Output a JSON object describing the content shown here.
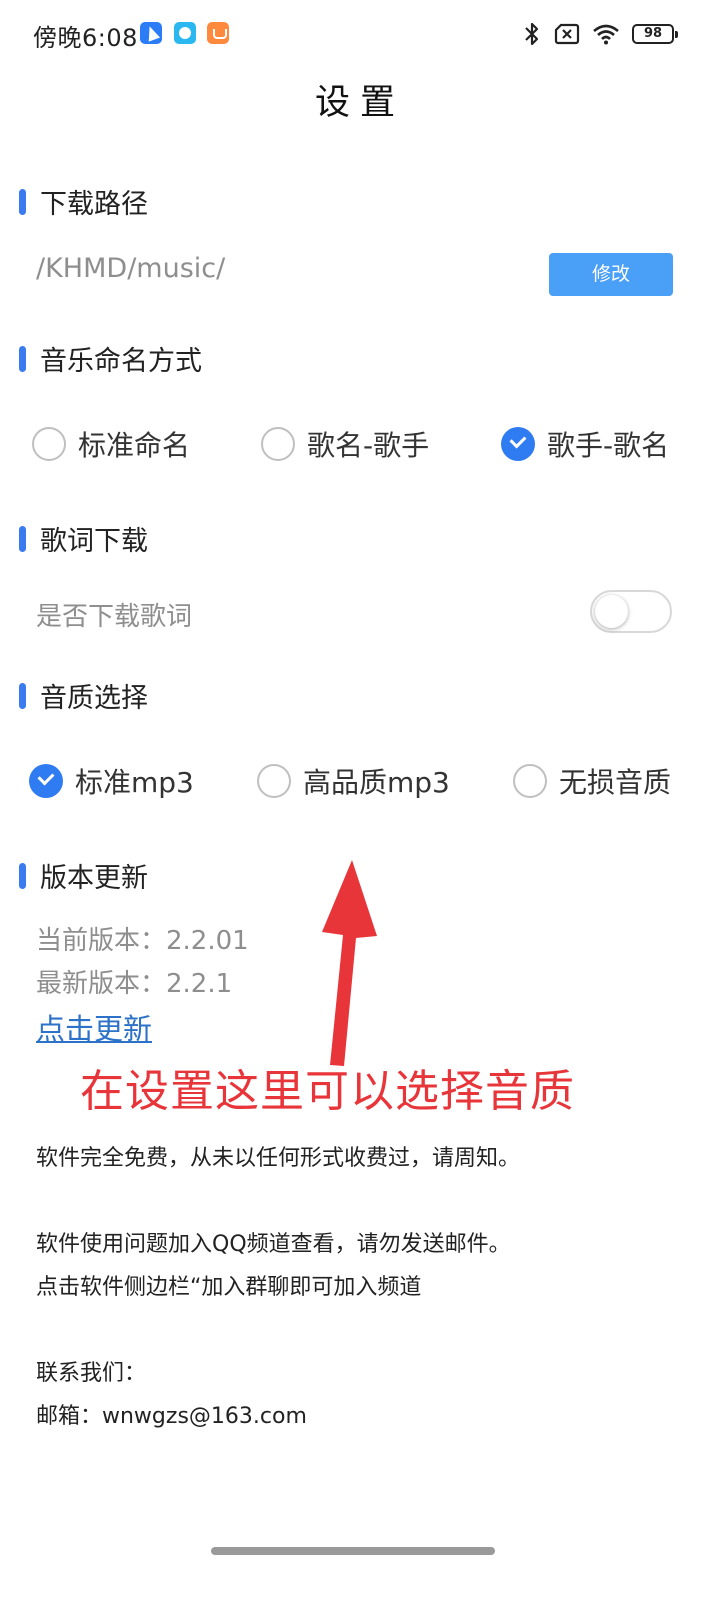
{
  "status_bar": {
    "time": "傍晚6:08",
    "battery": "98",
    "icons": [
      "app-icon-1",
      "app-icon-2",
      "app-icon-3",
      "bluetooth-icon",
      "no-sim-icon",
      "wifi-icon",
      "battery-icon"
    ]
  },
  "page": {
    "title": "设置"
  },
  "download_path": {
    "header": "下载路径",
    "path": "/KHMD/music/",
    "modify_label": "修改"
  },
  "naming": {
    "header": "音乐命名方式",
    "options": [
      {
        "label": "标准命名",
        "checked": false
      },
      {
        "label": "歌名-歌手",
        "checked": false
      },
      {
        "label": "歌手-歌名",
        "checked": true
      }
    ]
  },
  "lyrics": {
    "header": "歌词下载",
    "label": "是否下载歌词",
    "enabled": false
  },
  "quality": {
    "header": "音质选择",
    "options": [
      {
        "label": "标准mp3",
        "checked": true
      },
      {
        "label": "高品质mp3",
        "checked": false
      },
      {
        "label": "无损音质",
        "checked": false
      }
    ]
  },
  "version": {
    "header": "版本更新",
    "current": "当前版本：2.2.01",
    "latest": "最新版本：2.2.1",
    "update_link": "点击更新"
  },
  "annotation": {
    "text": "在设置这里可以选择音质",
    "color": "#e8353a"
  },
  "info": {
    "free_notice": "软件完全免费，从未以任何形式收费过，请周知。",
    "qq_notice": "软件使用问题加入QQ频道查看，请勿发送邮件。",
    "sidebar_notice": "点击软件侧边栏“加入群聊即可加入频道",
    "contact_title": "联系我们：",
    "email": "邮箱：wnwgzs@163.com"
  },
  "colors": {
    "accent": "#3a7bf0",
    "button": "#4a9ff7",
    "link": "#2d72c9"
  }
}
